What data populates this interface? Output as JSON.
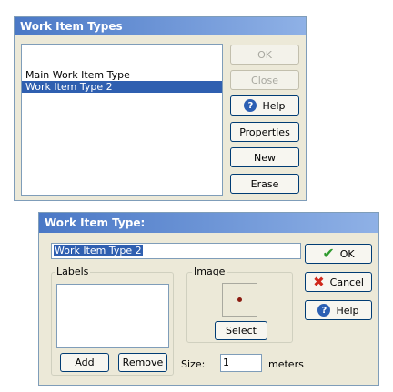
{
  "types_dialog": {
    "title": "Work Item Types",
    "items": [
      {
        "label": "Main Work Item Type",
        "selected": false
      },
      {
        "label": "Work Item Type  2",
        "selected": true
      }
    ],
    "buttons": {
      "ok": "OK",
      "close": "Close",
      "help": "Help",
      "properties": "Properties",
      "new": "New",
      "erase": "Erase"
    }
  },
  "type_dialog": {
    "title": "Work Item Type:",
    "name_value": "Work Item Type  2",
    "labels_group": "Labels",
    "image_group": "Image",
    "buttons": {
      "ok": "OK",
      "cancel": "Cancel",
      "help": "Help",
      "select": "Select",
      "add": "Add",
      "remove": "Remove"
    },
    "size_label": "Size:",
    "size_value": "1",
    "size_unit": "meters"
  },
  "colors": {
    "titlebar": "#4a78c6",
    "selection": "#2f5fb0",
    "dialog_bg": "#ece9d8",
    "ok_check": "#2e9a2e",
    "cancel_x": "#d0281c"
  },
  "icons": [
    "help-icon",
    "check-icon",
    "cancel-x-icon",
    "image-preview-dot-icon"
  ]
}
